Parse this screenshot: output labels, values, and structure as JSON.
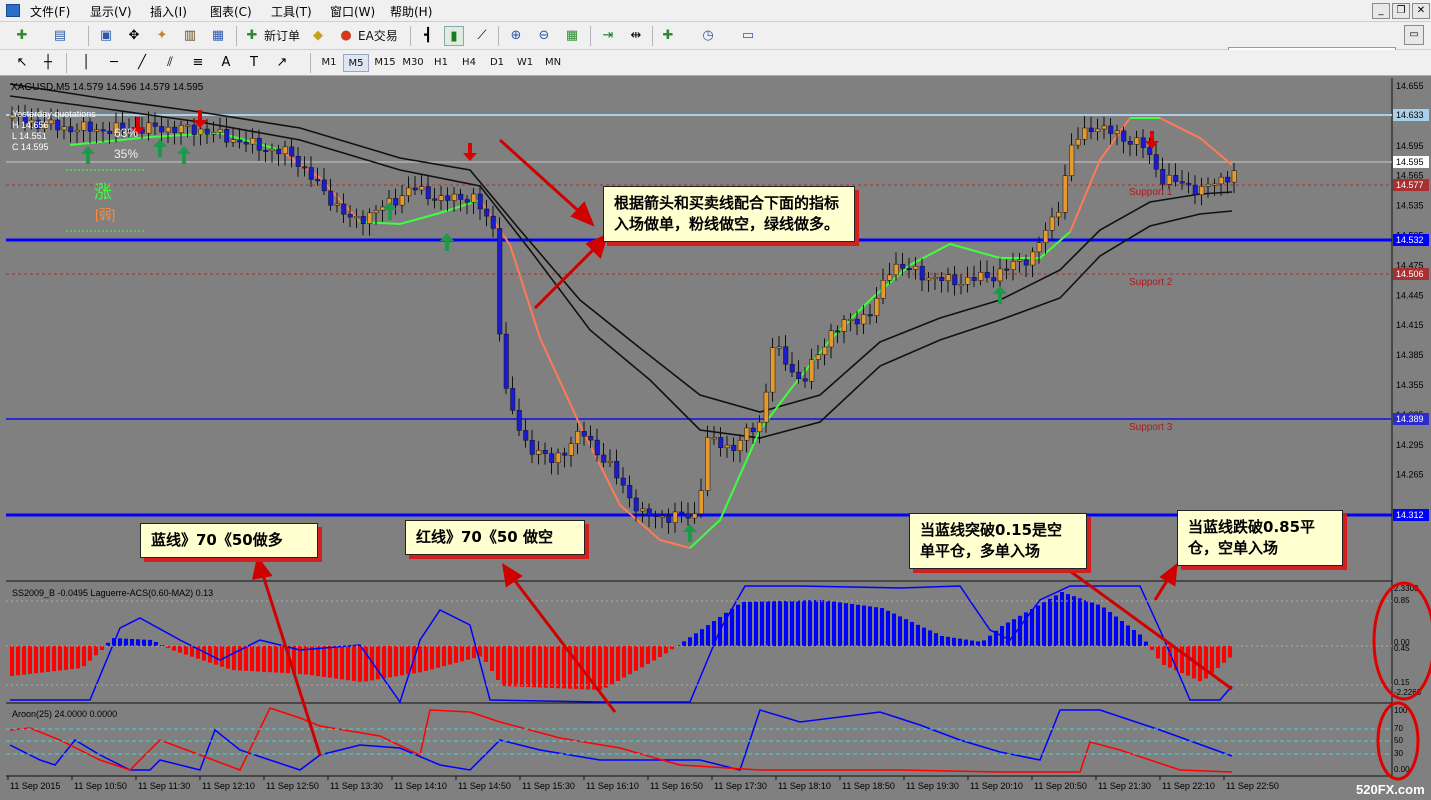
{
  "menu": [
    "文件(F)",
    "显示(V)",
    "插入(I)",
    "图表(C)",
    "工具(T)",
    "窗口(W)",
    "帮助(H)"
  ],
  "window_controls": [
    "_",
    "❐",
    "✕"
  ],
  "toolbar": {
    "new_order": "新订单",
    "ea_trading": "EA交易",
    "search_placeholder": ""
  },
  "timeframes": [
    "M1",
    "M5",
    "M15",
    "M30",
    "H1",
    "H4",
    "D1",
    "W1",
    "MN"
  ],
  "active_timeframe": "M5",
  "chart": {
    "header": "XAGUSD,M5  14.579 14.596 14.579 14.595",
    "yesterday": "Yesterday quotations",
    "hl": [
      "H 14.656",
      "L 14.551",
      "C 14.595"
    ],
    "pct1": "63%",
    "pct2": "35%",
    "trend": "涨",
    "strength": "[弱]",
    "price_axis": [
      "14.655",
      "14.625",
      "14.595",
      "14.565",
      "14.535",
      "14.505",
      "14.475",
      "14.445",
      "14.415",
      "14.385",
      "14.355",
      "14.325",
      "14.295",
      "14.265"
    ],
    "price_tags": [
      "14.633",
      "14.595",
      "14.577",
      "14.532",
      "14.506",
      "14.389",
      "14.312"
    ],
    "supports": [
      "Support 1",
      "Support 2",
      "Support 3"
    ],
    "ind1_label": "SS2009_B -0.0495  Laguerre-ACS(0.60-MA2) 0.13",
    "ind1_axis": [
      "2.3303",
      "0.85",
      "0.00",
      "0.45",
      "0.15",
      "-2.2263"
    ],
    "ind2_label": "Aroon(25) 24.0000 0.0000",
    "ind2_axis": [
      "100",
      "70",
      "50",
      "30",
      "0.00"
    ],
    "time_axis": [
      "11 Sep 2015",
      "11 Sep 10:50",
      "11 Sep 11:30",
      "11 Sep 12:10",
      "11 Sep 12:50",
      "11 Sep 13:30",
      "11 Sep 14:10",
      "11 Sep 14:50",
      "11 Sep 15:30",
      "11 Sep 16:10",
      "11 Sep 16:50",
      "11 Sep 17:30",
      "11 Sep 18:10",
      "11 Sep 18:50",
      "11 Sep 19:30",
      "11 Sep 20:10",
      "11 Sep 20:50",
      "11 Sep 21:30",
      "11 Sep 22:10",
      "11 Sep 22:50"
    ],
    "watermark": "520FX.com"
  },
  "annotations": {
    "main": "根据箭头和买卖线配合下面的指标入场做单，粉线做空，绿线做多。",
    "blue": "蓝线》70《50做多",
    "red": "红线》70《50 做空",
    "cross015": "当蓝线突破0.15是空单平仓，多单入场",
    "cross085": "当蓝线跌破0.85平仓，空单入场"
  },
  "colors": {
    "bg": "#808080",
    "bull": "#e69a2e",
    "bear": "#1b1bd0",
    "green": "#3dff3d",
    "pink": "#ff7a55",
    "blue": "#0000ff",
    "red": "#ff0000",
    "arrow": "#dd0000"
  }
}
